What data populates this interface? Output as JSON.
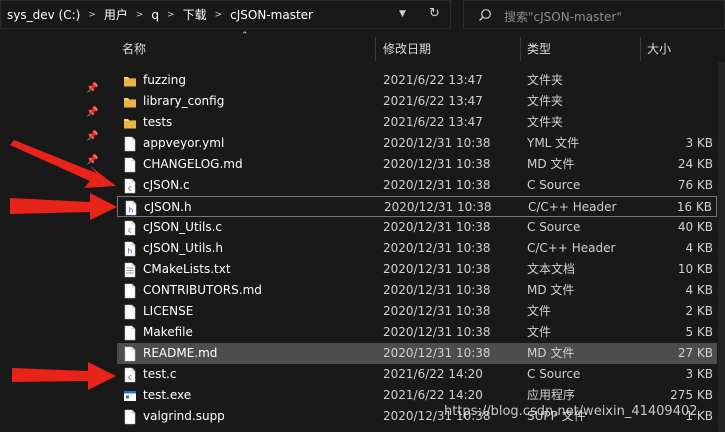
{
  "address": {
    "crumbs": [
      "sys_dev (C:)",
      "用户",
      "q",
      "下载",
      "cJSON-master"
    ]
  },
  "search": {
    "placeholder": "搜索\"cJSON-master\""
  },
  "columns": {
    "name": "名称",
    "date": "修改日期",
    "type": "类型",
    "size": "大小"
  },
  "files": [
    {
      "name": "fuzzing",
      "date": "2021/6/22 13:47",
      "type": "文件夹",
      "size": "",
      "icon": "folder"
    },
    {
      "name": "library_config",
      "date": "2021/6/22 13:47",
      "type": "文件夹",
      "size": "",
      "icon": "folder"
    },
    {
      "name": "tests",
      "date": "2021/6/22 13:47",
      "type": "文件夹",
      "size": "",
      "icon": "folder"
    },
    {
      "name": "appveyor.yml",
      "date": "2020/12/31 10:38",
      "type": "YML 文件",
      "size": "3 KB",
      "icon": "file"
    },
    {
      "name": "CHANGELOG.md",
      "date": "2020/12/31 10:38",
      "type": "MD 文件",
      "size": "24 KB",
      "icon": "file"
    },
    {
      "name": "cJSON.c",
      "date": "2020/12/31 10:38",
      "type": "C Source",
      "size": "76 KB",
      "icon": "c-source"
    },
    {
      "name": "cJSON.h",
      "date": "2020/12/31 10:38",
      "type": "C/C++ Header",
      "size": "16 KB",
      "icon": "c-header"
    },
    {
      "name": "cJSON_Utils.c",
      "date": "2020/12/31 10:38",
      "type": "C Source",
      "size": "40 KB",
      "icon": "c-source"
    },
    {
      "name": "cJSON_Utils.h",
      "date": "2020/12/31 10:38",
      "type": "C/C++ Header",
      "size": "4 KB",
      "icon": "c-header"
    },
    {
      "name": "CMakeLists.txt",
      "date": "2020/12/31 10:38",
      "type": "文本文档",
      "size": "10 KB",
      "icon": "text"
    },
    {
      "name": "CONTRIBUTORS.md",
      "date": "2020/12/31 10:38",
      "type": "MD 文件",
      "size": "4 KB",
      "icon": "file"
    },
    {
      "name": "LICENSE",
      "date": "2020/12/31 10:38",
      "type": "文件",
      "size": "2 KB",
      "icon": "file"
    },
    {
      "name": "Makefile",
      "date": "2020/12/31 10:38",
      "type": "文件",
      "size": "5 KB",
      "icon": "file"
    },
    {
      "name": "README.md",
      "date": "2020/12/31 10:38",
      "type": "MD 文件",
      "size": "27 KB",
      "icon": "file"
    },
    {
      "name": "test.c",
      "date": "2021/6/22 14:20",
      "type": "C Source",
      "size": "3 KB",
      "icon": "c-source"
    },
    {
      "name": "test.exe",
      "date": "2021/6/22 14:20",
      "type": "应用程序",
      "size": "275 KB",
      "icon": "exe"
    },
    {
      "name": "valgrind.supp",
      "date": "2020/12/31 10:38",
      "type": "SUPP 文件",
      "size": "1 KB",
      "icon": "file"
    }
  ],
  "selected_file": "README.md",
  "focused_file": "cJSON.h",
  "watermark": "https://blog.csdn.net/weixin_41409402",
  "colors": {
    "background": "#191919",
    "folder": "#ffd25c",
    "arrow": "#e8231a",
    "selected": "#4d4d4d"
  }
}
